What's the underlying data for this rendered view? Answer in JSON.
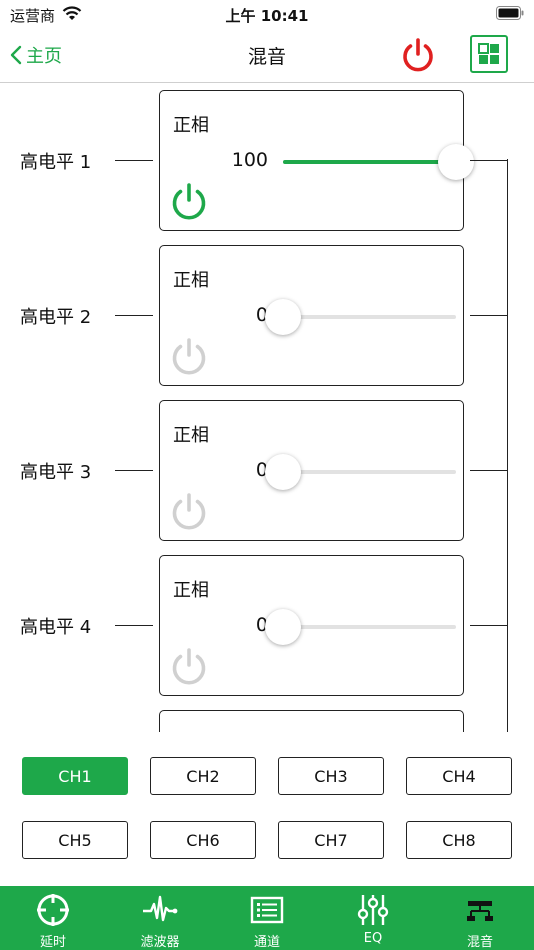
{
  "status_bar": {
    "carrier": "运营商",
    "time": "上午 10:41"
  },
  "nav": {
    "back_label": "主页",
    "title": "混音"
  },
  "rows": [
    {
      "label": "高电平 1",
      "phase": "正相",
      "value": "100",
      "level": 1.0,
      "enabled": true
    },
    {
      "label": "高电平 2",
      "phase": "正相",
      "value": "0",
      "level": 0.0,
      "enabled": false
    },
    {
      "label": "高电平 3",
      "phase": "正相",
      "value": "0",
      "level": 0.0,
      "enabled": false
    },
    {
      "label": "高电平 4",
      "phase": "正相",
      "value": "0",
      "level": 0.0,
      "enabled": false
    }
  ],
  "channels": [
    "CH1",
    "CH2",
    "CH3",
    "CH4",
    "CH5",
    "CH6",
    "CH7",
    "CH8"
  ],
  "active_channel": "CH1",
  "tabs": [
    {
      "label": "延时",
      "icon": "crosshair-icon"
    },
    {
      "label": "滤波器",
      "icon": "waveform-icon"
    },
    {
      "label": "通道",
      "icon": "list-icon"
    },
    {
      "label": "EQ",
      "icon": "equalizer-sliders-icon"
    },
    {
      "label": "混音",
      "icon": "mixer-network-icon"
    }
  ],
  "colors": {
    "accent": "#1ea84a",
    "power_off": "#e02020",
    "inactive": "#d0d0d0"
  }
}
